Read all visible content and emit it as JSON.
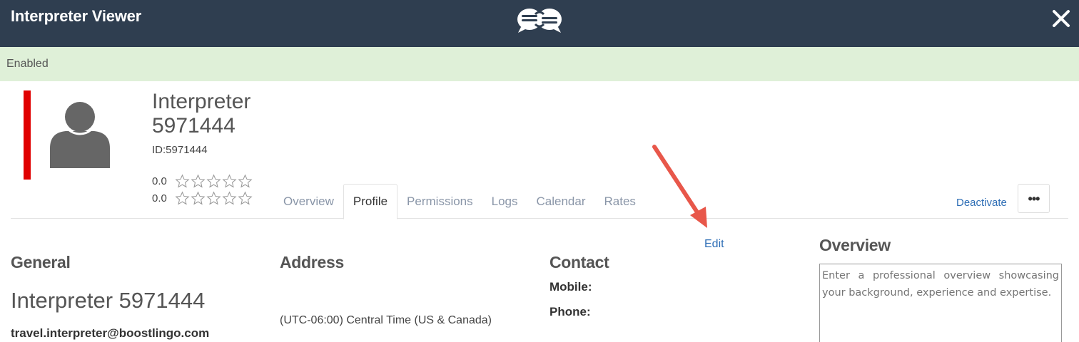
{
  "header": {
    "title": "Interpreter Viewer",
    "logo_icon": "chat-bubbles-logo-icon",
    "close_icon": "close-icon",
    "background": "#2f3e50"
  },
  "status": {
    "text": "Enabled",
    "background": "#dff0d8"
  },
  "profile": {
    "status_color": "#e00000",
    "avatar_icon": "user-avatar-icon",
    "name": "Interpreter 5971444",
    "name_line1": "Interpreter",
    "name_line2": "5971444",
    "id_label": "ID:",
    "id_value": "5971444",
    "ratings": [
      {
        "value": "0.0",
        "stars": 0,
        "max": 5
      },
      {
        "value": "0.0",
        "stars": 0,
        "max": 5
      }
    ]
  },
  "tabs": [
    {
      "label": "Overview",
      "active": false
    },
    {
      "label": "Profile",
      "active": true
    },
    {
      "label": "Permissions",
      "active": false
    },
    {
      "label": "Logs",
      "active": false
    },
    {
      "label": "Calendar",
      "active": false
    },
    {
      "label": "Rates",
      "active": false
    }
  ],
  "actions": {
    "deactivate_label": "Deactivate",
    "more_label": "•••",
    "edit_label": "Edit",
    "accent_color": "#2d6db5"
  },
  "general": {
    "heading": "General",
    "full_name": "Interpreter 5971444",
    "email": "travel.interpreter@boostlingo.com"
  },
  "address": {
    "heading": "Address",
    "timezone": "(UTC-06:00) Central Time (US & Canada)"
  },
  "contact": {
    "heading": "Contact",
    "mobile_label": "Mobile:",
    "phone_label": "Phone:"
  },
  "overview": {
    "heading": "Overview",
    "placeholder": "Enter a professional overview showcasing your background, experience and expertise."
  }
}
